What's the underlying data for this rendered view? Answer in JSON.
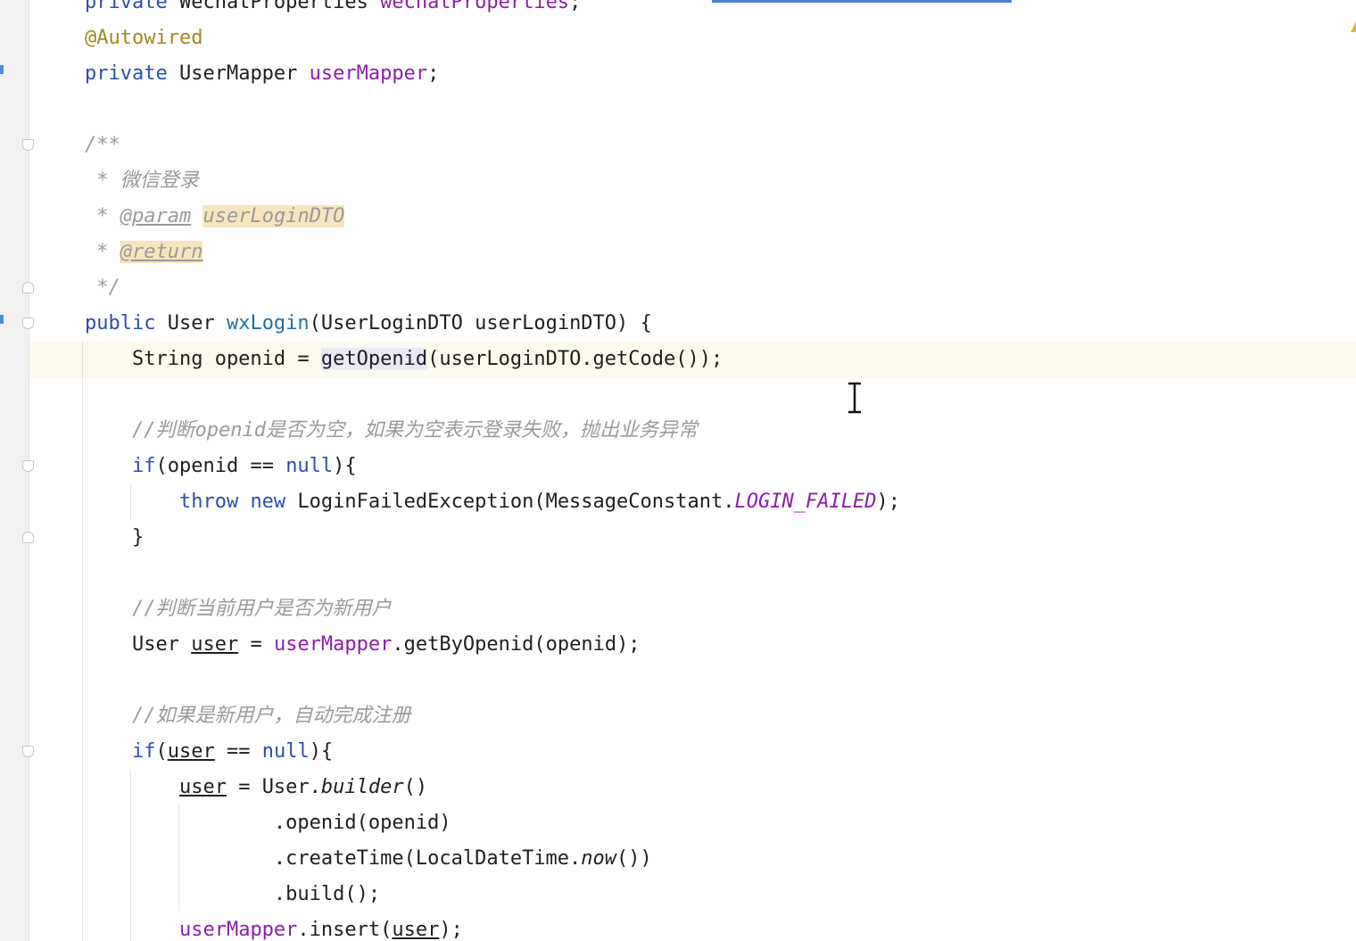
{
  "editor": {
    "lines": [
      {
        "id": "l0",
        "segments": [
          {
            "t": "private ",
            "c": "kw"
          },
          {
            "t": "WechatProperties ",
            "c": ""
          },
          {
            "t": "wechatProperties",
            "c": "field"
          },
          {
            "t": ";",
            "c": ""
          }
        ]
      },
      {
        "id": "l1",
        "segments": [
          {
            "t": "@Autowired",
            "c": "annot"
          }
        ]
      },
      {
        "id": "l2",
        "segments": [
          {
            "t": "private ",
            "c": "kw"
          },
          {
            "t": "UserMapper ",
            "c": ""
          },
          {
            "t": "userMapper",
            "c": "field"
          },
          {
            "t": ";",
            "c": ""
          }
        ]
      },
      {
        "id": "l3",
        "segments": []
      },
      {
        "id": "l4",
        "segments": [
          {
            "t": "/**",
            "c": "comment"
          }
        ]
      },
      {
        "id": "l5",
        "segments": [
          {
            "t": " * 微信登录",
            "c": "comment"
          }
        ]
      },
      {
        "id": "l6",
        "segments": [
          {
            "t": " * ",
            "c": "comment"
          },
          {
            "t": "@param",
            "c": "doc-tag"
          },
          {
            "t": " ",
            "c": "comment"
          },
          {
            "t": "userLoginDTO",
            "c": "comment doc-hl"
          }
        ]
      },
      {
        "id": "l7",
        "segments": [
          {
            "t": " * ",
            "c": "comment"
          },
          {
            "t": "@return",
            "c": "doc-tag doc-hl"
          }
        ]
      },
      {
        "id": "l8",
        "segments": [
          {
            "t": " */",
            "c": "comment"
          }
        ]
      },
      {
        "id": "l9",
        "segments": [
          {
            "t": "public ",
            "c": "kw"
          },
          {
            "t": "User ",
            "c": ""
          },
          {
            "t": "wxLogin",
            "c": "method"
          },
          {
            "t": "(UserLoginDTO userLoginDTO) {",
            "c": ""
          }
        ]
      },
      {
        "id": "l10",
        "segments": [
          {
            "t": "    String openid = ",
            "c": ""
          },
          {
            "t": "getOpenid",
            "c": "call-hl"
          },
          {
            "t": "(userLoginDTO.getCode());",
            "c": ""
          }
        ]
      },
      {
        "id": "l11",
        "segments": []
      },
      {
        "id": "l12",
        "segments": [
          {
            "t": "    //判断openid是否为空，如果为空表示登录失败，抛出业务异常",
            "c": "comment"
          }
        ]
      },
      {
        "id": "l13",
        "segments": [
          {
            "t": "    ",
            "c": ""
          },
          {
            "t": "if",
            "c": "kw"
          },
          {
            "t": "(openid == ",
            "c": ""
          },
          {
            "t": "null",
            "c": "kw"
          },
          {
            "t": "){",
            "c": ""
          }
        ]
      },
      {
        "id": "l14",
        "segments": [
          {
            "t": "        ",
            "c": ""
          },
          {
            "t": "throw new ",
            "c": "kw"
          },
          {
            "t": "LoginFailedException(MessageConstant.",
            "c": ""
          },
          {
            "t": "LOGIN_FAILED",
            "c": "const"
          },
          {
            "t": ");",
            "c": ""
          }
        ]
      },
      {
        "id": "l15",
        "segments": [
          {
            "t": "    }",
            "c": ""
          }
        ]
      },
      {
        "id": "l16",
        "segments": []
      },
      {
        "id": "l17",
        "segments": [
          {
            "t": "    //判断当前用户是否为新用户",
            "c": "comment"
          }
        ]
      },
      {
        "id": "l18",
        "segments": [
          {
            "t": "    User ",
            "c": ""
          },
          {
            "t": "user",
            "c": "var-ul"
          },
          {
            "t": " = ",
            "c": ""
          },
          {
            "t": "userMapper",
            "c": "field"
          },
          {
            "t": ".getByOpenid(openid);",
            "c": ""
          }
        ]
      },
      {
        "id": "l19",
        "segments": []
      },
      {
        "id": "l20",
        "segments": [
          {
            "t": "    //如果是新用户，自动完成注册",
            "c": "comment"
          }
        ]
      },
      {
        "id": "l21",
        "segments": [
          {
            "t": "    ",
            "c": ""
          },
          {
            "t": "if",
            "c": "kw"
          },
          {
            "t": "(",
            "c": ""
          },
          {
            "t": "user",
            "c": "var-ul"
          },
          {
            "t": " == ",
            "c": ""
          },
          {
            "t": "null",
            "c": "kw"
          },
          {
            "t": "){",
            "c": ""
          }
        ]
      },
      {
        "id": "l22",
        "segments": [
          {
            "t": "        ",
            "c": ""
          },
          {
            "t": "user",
            "c": "var-ul"
          },
          {
            "t": " = User.",
            "c": ""
          },
          {
            "t": "builder",
            "c": "static-call"
          },
          {
            "t": "()",
            "c": ""
          }
        ]
      },
      {
        "id": "l23",
        "segments": [
          {
            "t": "                .openid(openid)",
            "c": ""
          }
        ]
      },
      {
        "id": "l24",
        "segments": [
          {
            "t": "                .createTime(LocalDateTime.",
            "c": ""
          },
          {
            "t": "now",
            "c": "static-call"
          },
          {
            "t": "())",
            "c": ""
          }
        ]
      },
      {
        "id": "l25",
        "segments": [
          {
            "t": "                .build();",
            "c": ""
          }
        ]
      },
      {
        "id": "l26",
        "segments": [
          {
            "t": "        ",
            "c": ""
          },
          {
            "t": "userMapper",
            "c": "field"
          },
          {
            "t": ".insert(",
            "c": ""
          },
          {
            "t": "user",
            "c": "var-ul"
          },
          {
            "t": ");",
            "c": ""
          }
        ]
      }
    ]
  },
  "colors": {
    "keyword": "#2a4fb0",
    "field": "#8b1fa8",
    "comment": "#9a9a9a",
    "annotation": "#9b8a1e",
    "current_line": "#fcfaed",
    "doc_highlight": "#f7e6bd"
  },
  "icons": {
    "cursor": "text-cursor-icon",
    "fold": "fold-marker-icon",
    "warning": "warning-marker-icon"
  }
}
